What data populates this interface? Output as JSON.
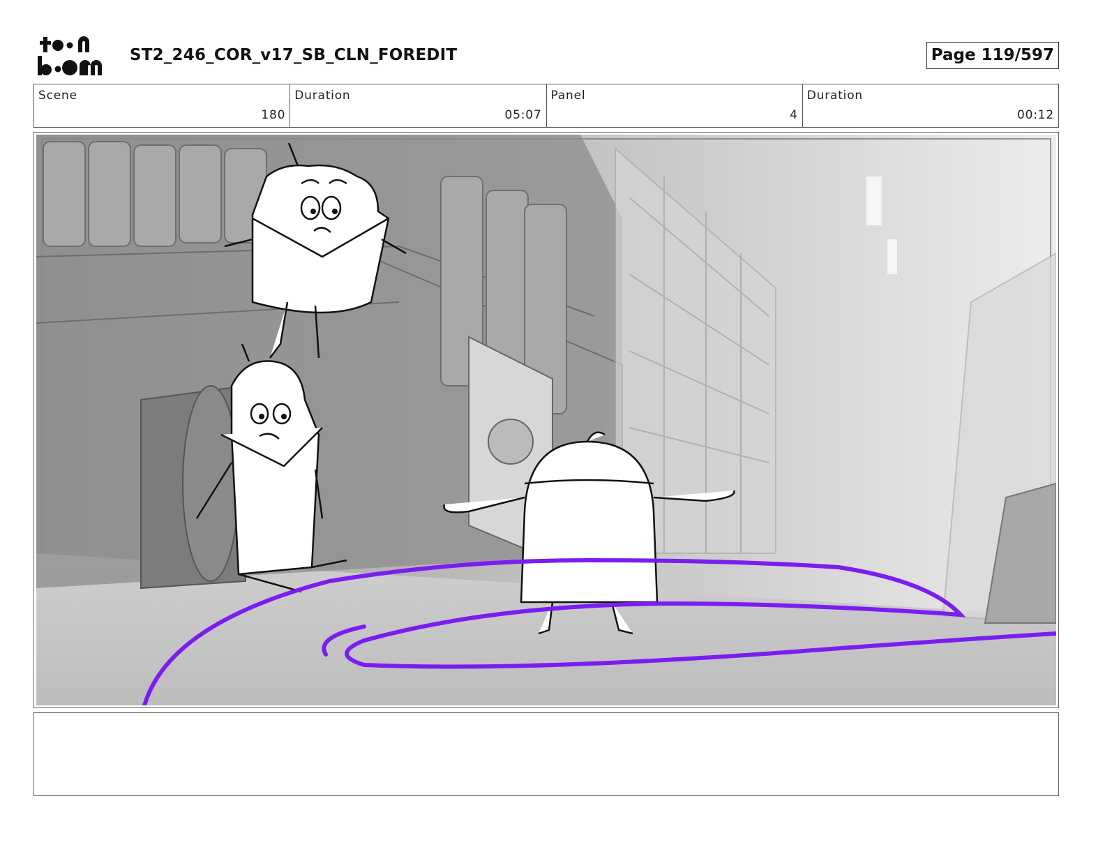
{
  "header": {
    "logo": {
      "icon": "toon-boom-logo",
      "line1": "toon",
      "line2": "boom"
    },
    "title": "ST2_246_COR_v17_SB_CLN_FOREDIT",
    "page_label": "Page 119/597"
  },
  "info": {
    "scene_label": "Scene",
    "scene_value": "180",
    "scene_duration_label": "Duration",
    "scene_duration_value": "05:07",
    "panel_label": "Panel",
    "panel_value": "4",
    "panel_duration_label": "Duration",
    "panel_duration_value": "00:12"
  },
  "panel": {
    "description": "storyboard-drawing",
    "motion_path_color": "#7a1ef0"
  },
  "notes": {
    "text": ""
  }
}
